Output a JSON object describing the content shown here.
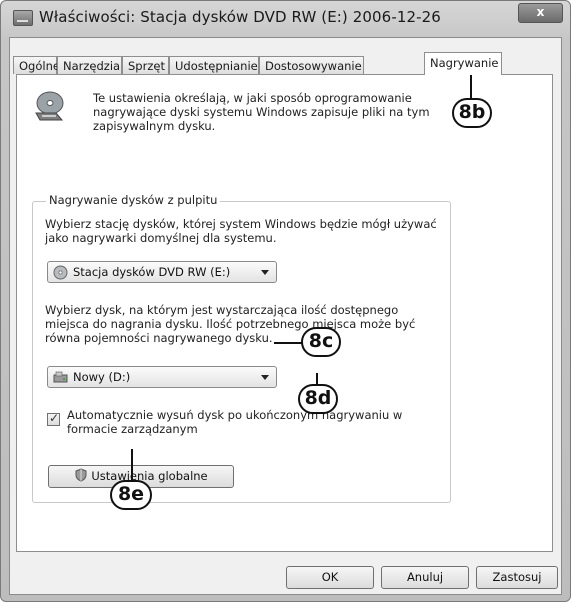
{
  "window": {
    "title": "Właściwości: Stacja dysków DVD RW (E:) 2006-12-26",
    "close_glyph": "x"
  },
  "tabs": [
    {
      "label": "Ogólne"
    },
    {
      "label": "Narzędzia"
    },
    {
      "label": "Sprzęt"
    },
    {
      "label": "Udostępnianie"
    },
    {
      "label": "Dostosowywanie"
    },
    {
      "label": "Nagrywanie",
      "active": true
    }
  ],
  "intro": {
    "text": "Te ustawienia określają, w jaki sposób oprogramowanie nagrywające dyski systemu Windows zapisuje pliki na tym zapisywalnym dysku.",
    "icon": "disc-burn-icon"
  },
  "group": {
    "legend": "Nagrywanie dysków z pulpitu",
    "drive_desc": "Wybierz stację dysków, której system Windows będzie mógł używać jako nagrywarki domyślnej dla systemu.",
    "drive_select": "Stacja dysków DVD RW (E:)",
    "temp_desc": "Wybierz dysk, na którym jest wystarczająca ilość dostępnego miejsca do nagrania dysku. Ilość potrzebnego miejsca może być równa pojemności nagrywanego dysku.",
    "temp_select": "Nowy (D:)",
    "eject_label": "Automatycznie wysuń dysk po ukończonym nagrywaniu w formacie zarządzanym",
    "eject_checked": true,
    "global_button": "Ustawienia globalne"
  },
  "buttons": {
    "ok": "OK",
    "cancel": "Anuluj",
    "apply": "Zastosuj"
  },
  "callouts": {
    "b": "8b",
    "c": "8c",
    "d": "8d",
    "e": "8e"
  }
}
